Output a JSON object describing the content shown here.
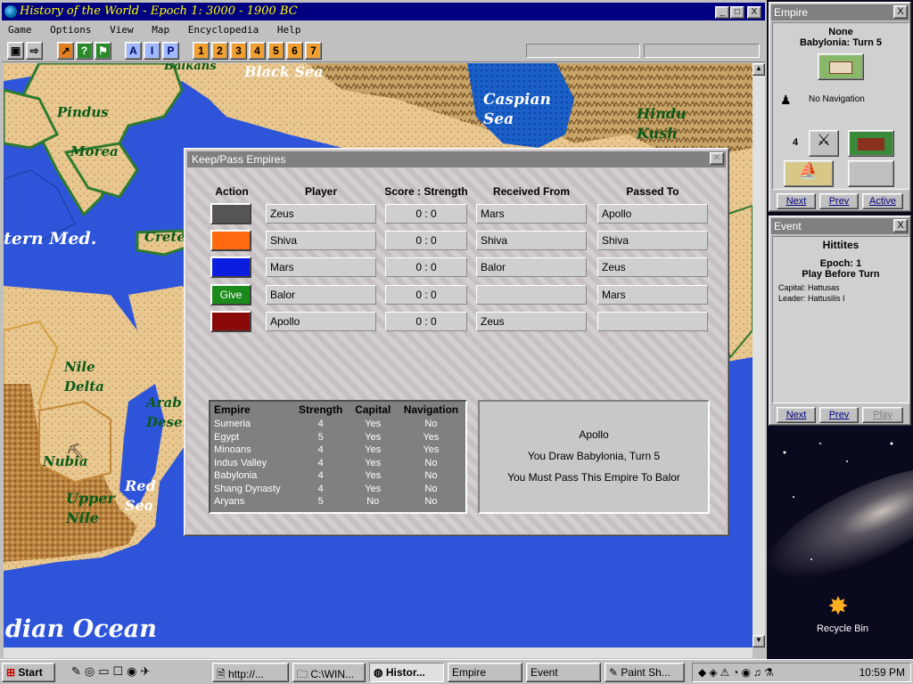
{
  "window": {
    "title": "History of the World - Epoch 1: 3000 - 1900 BC",
    "controls": [
      "_",
      "□",
      "X"
    ]
  },
  "menu": [
    "Game",
    "Options",
    "View",
    "Map",
    "Encyclopedia",
    "Help"
  ],
  "toolbar": {
    "letter_buttons": [
      "A",
      "I",
      "P"
    ],
    "number_buttons": [
      "1",
      "2",
      "3",
      "4",
      "5",
      "6",
      "7"
    ]
  },
  "map_labels": {
    "black_sea": "Black Sea",
    "balkans": "Balkans",
    "caspian_sea": "Caspian Sea",
    "pindus": "Pindus",
    "morea": "Morea",
    "hindu_kush": "Hindu Kush",
    "crete": "Crete",
    "eastern_med": "tern Med.",
    "nile_delta": "Nile Delta",
    "arabian_desert": "Arab Deser",
    "nubia": "Nubia",
    "upper_nile": "Upper Nile",
    "red_sea": "Red Sea",
    "indian_ocean": "dian Ocean"
  },
  "dialog": {
    "title": "Keep/Pass Empires",
    "headers": {
      "action": "Action",
      "player": "Player",
      "score": "Score : Strength",
      "received": "Received From",
      "passed": "Passed To"
    },
    "rows": [
      {
        "action_label": "",
        "action_color": "#555555",
        "player": "Zeus",
        "score": "0 : 0",
        "received": "Mars",
        "passed": "Apollo"
      },
      {
        "action_label": "",
        "action_color": "#ff6a10",
        "player": "Shiva",
        "score": "0 : 0",
        "received": "Shiva",
        "passed": "Shiva"
      },
      {
        "action_label": "",
        "action_color": "#0b1ee0",
        "player": "Mars",
        "score": "0 : 0",
        "received": "Balor",
        "passed": "Zeus"
      },
      {
        "action_label": "Give",
        "action_color": "#1a8a1a",
        "player": "Balor",
        "score": "0 : 0",
        "received": "",
        "passed": "Mars"
      },
      {
        "action_label": "",
        "action_color": "#8a0a0a",
        "player": "Apollo",
        "score": "0 : 0",
        "received": "Zeus",
        "passed": ""
      }
    ],
    "empire_table": {
      "headers": [
        "Empire",
        "Strength",
        "Capital",
        "Navigation"
      ],
      "rows": [
        [
          "Sumeria",
          "4",
          "Yes",
          "No"
        ],
        [
          "Egypt",
          "5",
          "Yes",
          "Yes"
        ],
        [
          "Minoans",
          "4",
          "Yes",
          "Yes"
        ],
        [
          "Indus Valley",
          "4",
          "Yes",
          "No"
        ],
        [
          "Babylonia",
          "4",
          "Yes",
          "No"
        ],
        [
          "Shang Dynasty",
          "4",
          "Yes",
          "No"
        ],
        [
          "Aryans",
          "5",
          "No",
          "No"
        ]
      ]
    },
    "message": {
      "line1": "Apollo",
      "line2": "You Draw Babylonia, Turn 5",
      "line3": "You Must Pass This Empire To Balor"
    }
  },
  "empire_panel": {
    "title": "Empire",
    "close": "X",
    "none": "None",
    "subtitle": "Babylonia: Turn 5",
    "navigation": "No Navigation",
    "strength": "4",
    "buttons": [
      "Next",
      "Prev",
      "Active"
    ]
  },
  "event_panel": {
    "title": "Event",
    "close": "X",
    "name": "Hittites",
    "epoch": "Epoch: 1",
    "play": "Play Before Turn",
    "capital": "Capital:  Hattusas",
    "leader": "Leader:  Hattusilis I",
    "buttons": [
      "Next",
      "Prev",
      "Play"
    ]
  },
  "desktop": {
    "recycle_bin": "Recycle Bin"
  },
  "taskbar": {
    "start": "Start",
    "items": [
      "http://...",
      "C:\\WIN...",
      "Histor...",
      "Empire",
      "Event",
      "Paint Sh..."
    ],
    "clock": "10:59 PM"
  }
}
